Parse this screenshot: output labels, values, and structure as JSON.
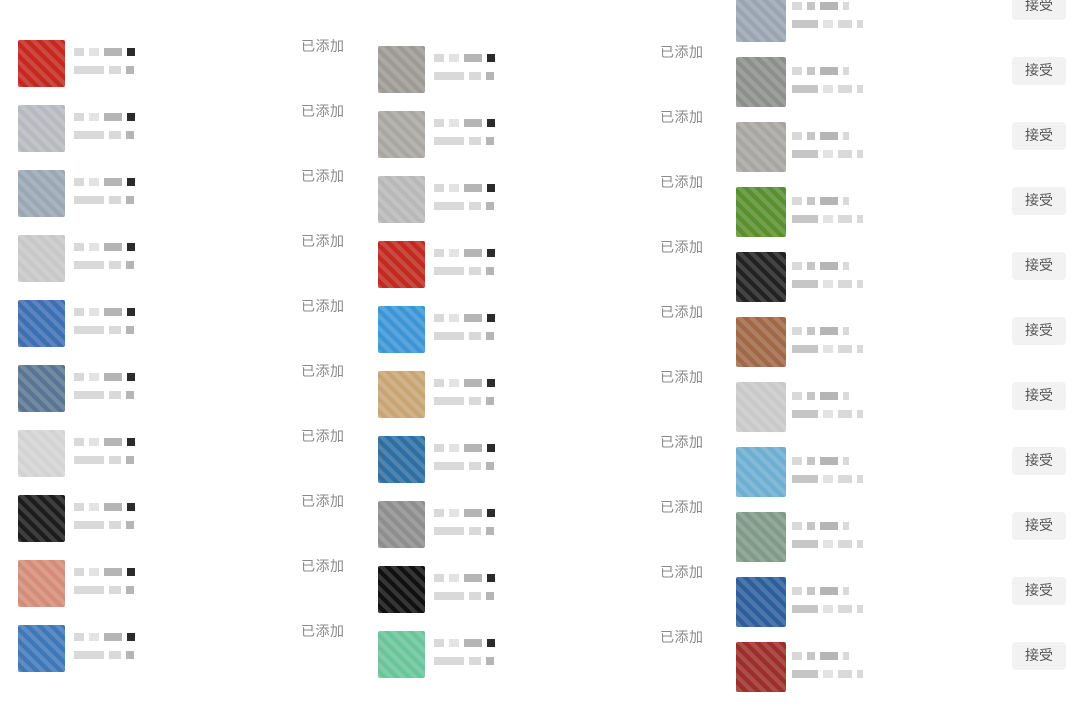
{
  "columns": [
    {
      "rows": [
        {
          "status": "已添加",
          "avatar": "#c4281f",
          "overlap": false
        },
        {
          "status": "已添加",
          "avatar": "#b7b9bf",
          "overlap": false
        },
        {
          "status": "已添加",
          "avatar": "#9aa7b4",
          "overlap": true
        },
        {
          "status": "已添加",
          "avatar": "#c8c8c8",
          "overlap": false
        },
        {
          "status": "已添加",
          "avatar": "#3d6fb4",
          "overlap": false
        },
        {
          "status": "已添加",
          "avatar": "#5a7593",
          "overlap": false
        },
        {
          "status": "已添加",
          "avatar": "#d3d3d3",
          "overlap": false
        },
        {
          "status": "已添加",
          "avatar": "#1c1c1c",
          "overlap": false
        },
        {
          "status": "已添加",
          "avatar": "#d58c78",
          "overlap": false
        },
        {
          "status": "已添加",
          "avatar": "#3f78b8",
          "overlap": false
        }
      ]
    },
    {
      "rows": [
        {
          "status": "已添加",
          "avatar": "#9c9a93",
          "overlap": false
        },
        {
          "status": "已添加",
          "avatar": "#a9a7a1",
          "overlap": false
        },
        {
          "status": "已添加",
          "avatar": "#b8b8b8",
          "overlap": true
        },
        {
          "status": "已添加",
          "avatar": "#c02a1f",
          "overlap": false
        },
        {
          "status": "已添加",
          "avatar": "#3d95d6",
          "overlap": false
        },
        {
          "status": "已添加",
          "avatar": "#c9a574",
          "overlap": false
        },
        {
          "status": "已添加",
          "avatar": "#2f6ea3",
          "overlap": false
        },
        {
          "status": "已添加",
          "avatar": "#8e8e8e",
          "overlap": false
        },
        {
          "status": "已添加",
          "avatar": "#111111",
          "overlap": false
        },
        {
          "status": "已添加",
          "avatar": "#6ac59a",
          "overlap": false
        }
      ]
    },
    {
      "rows": [
        {
          "action": "接受",
          "avatar": "#9aa5b1"
        },
        {
          "action": "接受",
          "avatar": "#8d8f8c"
        },
        {
          "action": "接受",
          "avatar": "#a7a6a2"
        },
        {
          "action": "接受",
          "avatar": "#5a8f2f",
          "double": true
        },
        {
          "action": "接受",
          "avatar": "#222222"
        },
        {
          "action": "接受",
          "avatar": "#a06846"
        },
        {
          "action": "接受",
          "avatar": "#c9c9c9"
        },
        {
          "action": "接受",
          "avatar": "#6eaed1"
        },
        {
          "action": "接受",
          "avatar": "#7f9b88"
        },
        {
          "action": "接受",
          "avatar": "#2e5f9c"
        },
        {
          "action": "接受",
          "avatar": "#9c2f2a"
        }
      ]
    }
  ]
}
